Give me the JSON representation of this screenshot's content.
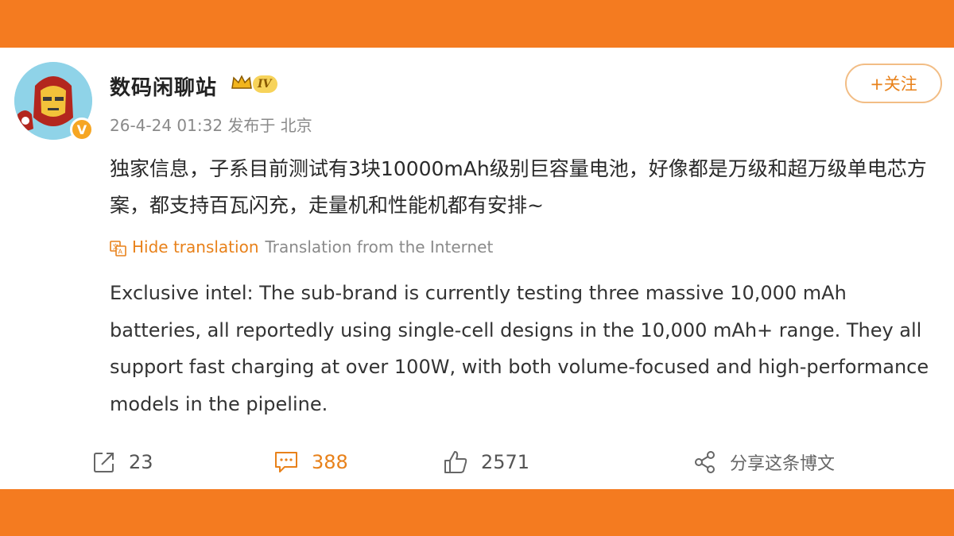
{
  "post": {
    "author": "数码闲聊站",
    "level_badge": "IV",
    "verified_mark": "V",
    "meta": "26-4-24 01:32 发布于 北京",
    "follow_label": "+关注",
    "text_cn": "独家信息，子系目前测试有3块10000mAh级别巨容量电池，好像都是万级和超万级单电芯方案，都支持百瓦闪充，走量机和性能机都有安排~",
    "translation": {
      "toggle_label": "Hide translation",
      "source_label": "Translation from the Internet",
      "text_en": "Exclusive intel: The sub-brand is currently testing three massive 10,000 mAh batteries, all reportedly using single-cell designs in the 10,000 mAh+ range. They all support fast charging at over 100W, with both volume-focused and high-performance models in the pipeline."
    }
  },
  "actions": {
    "repost_count": "23",
    "comment_count": "388",
    "like_count": "2571",
    "share_label": "分享这条博文"
  },
  "icons": {
    "repost": "repost-icon",
    "comment": "comment-icon",
    "like": "thumbs-up-icon",
    "share": "share-icon",
    "translate": "translate-icon",
    "crown": "crown-icon",
    "verified": "verified-badge-icon"
  },
  "colors": {
    "frame": "#f47b20",
    "accent": "#e8811a",
    "muted": "#8a8a8a"
  }
}
